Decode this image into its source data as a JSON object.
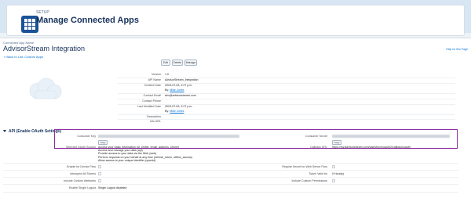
{
  "header": {
    "setup_label": "SETUP",
    "title": "Manage Connected Apps"
  },
  "page": {
    "breadcrumb": "Connected App Name",
    "title": "AdvisorStream Integration",
    "help_link": "Help for this Page",
    "back_link": "« Back to List: Custom Apps"
  },
  "buttons": {
    "edit": "Edit",
    "delete": "Delete",
    "manage": "Manage"
  },
  "detail": [
    {
      "label": "Version",
      "value": "1.0"
    },
    {
      "label": "API Name",
      "value": "AdvisorStream_Integration"
    },
    {
      "label": "Created Date",
      "value": "2023-07-03, 2:27 p.m."
    },
    {
      "label": "",
      "value": "By",
      "link": "Mike Jones"
    },
    {
      "label": "Contact Email",
      "value": "dev@advisorstream.com"
    },
    {
      "label": "Contact Phone",
      "value": ""
    },
    {
      "label": "Last Modified Date",
      "value": "2023-07-03, 2:27 p.m."
    },
    {
      "label": "",
      "value": "By",
      "link": "Mike Jones"
    },
    {
      "label": "Description",
      "value": ""
    },
    {
      "label": "Info URL",
      "value": ""
    }
  ],
  "oauth": {
    "section_title": "API (Enable OAuth Settings)",
    "consumer_key_label": "Consumer Key",
    "consumer_secret_label": "Consumer Secret",
    "copy_label": "Copy",
    "scopes_label": "Selected OAuth Scopes",
    "scopes": [
      "Access your basic information (id, profile, email, address, phone)",
      "Access and manage your data (api)",
      "Provide access to your data via the Web (web)",
      "Perform requests on your behalf at any time (refresh_token, offline_access)",
      "Allow access to your unique identifier (openid)"
    ],
    "callback_label": "Callback URL",
    "callback_value": "https://my.advisorstream.com/salesforce/oauth2/callback/oauth",
    "device_flow_label": "Enable for Device Flow",
    "secret_required_label": "Require Secret for Web Server Flow",
    "intro_refresh_label": "Introspect All Tokens",
    "token_valid_label": "Token Valid for",
    "token_valid_value": "0 Hour(s)",
    "custom_attr_label": "Include Custom Attributes",
    "custom_perm_label": "Include Custom Permissions",
    "single_logout_label": "Enable Single Logout",
    "single_logout_value": "Single Logout disabled"
  }
}
